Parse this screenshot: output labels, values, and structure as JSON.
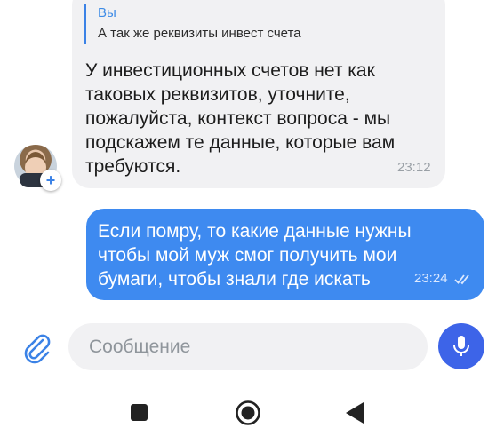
{
  "incoming": {
    "quote_author": "Вы",
    "quote_text": "А так же реквизиты инвест счета",
    "lines": [
      "У инвестиционных счетов нет как",
      "таковых реквизитов, уточните,",
      "пожалуйста, контекст вопроса - мы",
      "подскажем те данные, которые вам",
      "требуются."
    ],
    "time": "23:12"
  },
  "outgoing": {
    "lines": [
      "Если помру, то какие данные нужны",
      "чтобы мой муж смог получить мои",
      "бумаги, чтобы знали где искать"
    ],
    "time": "23:24",
    "status_icon": "double-check-icon"
  },
  "composer": {
    "placeholder": "Сообщение",
    "attach_icon": "paperclip-icon",
    "mic_icon": "microphone-icon"
  },
  "navigation": {
    "recents_icon": "square-icon",
    "home_icon": "circle-home-icon",
    "back_icon": "triangle-back-icon"
  },
  "colors": {
    "accent": "#3e8af0",
    "mic_button": "#3d64e8",
    "incoming_bubble": "#f1f1f3",
    "quote_bar": "#3b82e6"
  }
}
